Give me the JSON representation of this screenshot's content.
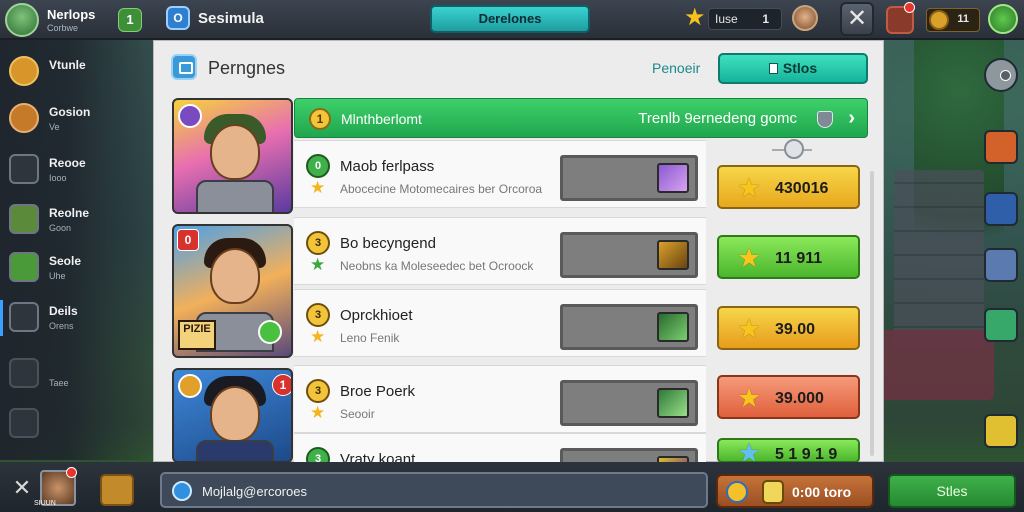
{
  "topbar": {
    "player_name": "Nerlops",
    "player_sub": "Corbwe",
    "badge": "1",
    "app_title": "Sesimula",
    "center_button": "Derelones",
    "currency_label": "Iuse",
    "currency_value": "1",
    "coin_value": "11"
  },
  "sidebar": {
    "items": [
      {
        "label": "Vtunle",
        "sub": ""
      },
      {
        "label": "Gosion",
        "sub": "Ve"
      },
      {
        "label": "Reooe",
        "sub": "Iooo"
      },
      {
        "label": "Reolne",
        "sub": "Goon"
      },
      {
        "label": "Seole",
        "sub": "Uhe"
      },
      {
        "label": "Deils",
        "sub": "Orens"
      },
      {
        "label": "",
        "sub": "Taee"
      }
    ]
  },
  "panel": {
    "title": "Perngnes",
    "link": "Penoeir",
    "button": "Stlos",
    "banner": {
      "number": "1",
      "left": "Mlnthberlomt",
      "right": "Trenlb 9ernedeng gomc"
    },
    "rows": [
      {
        "badge": "0",
        "title": "Maob ferlpass",
        "sub": "Abocecine Motomecaires ber Orcoroa"
      },
      {
        "badge": "3",
        "title": "Bo becyngend",
        "sub": "Neobns ka Moleseedec bet Ocroock"
      },
      {
        "badge": "3",
        "title": "Oprckhioet",
        "sub": "Leno Fenik"
      },
      {
        "badge": "3",
        "title": "Broe Poerk",
        "sub": "Seooir"
      },
      {
        "badge": "3",
        "title": "Vraty koant",
        "sub": ""
      }
    ],
    "prices": [
      "430016",
      "11 911",
      "39.00",
      "39.000",
      "5 1 9 1 9"
    ],
    "portraits": {
      "badge_red": "0",
      "tag": "PIZIE",
      "badge_red_2": "1"
    }
  },
  "bottombar": {
    "avatar_label": "SIUUN",
    "input_text": "Mojlalg@ercoroes",
    "reward_text": "0:00 toro",
    "green_button": "Stles"
  },
  "colors": {
    "accent_teal": "#2fc7b0",
    "banner_green": "#2fba5c",
    "price_yellow": "#f0c03a",
    "price_green": "#6ccc46",
    "price_orange": "#ea7a56"
  }
}
